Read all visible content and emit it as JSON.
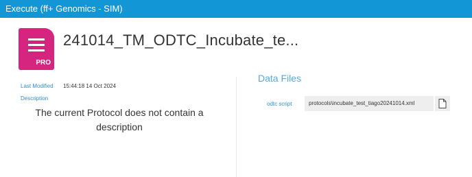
{
  "window": {
    "title": "Execute  (ff+ Genomics - SIM)"
  },
  "protocol": {
    "icon": "protocol-pro-icon",
    "icon_badge": "PRO",
    "icon_color": "#d6257f",
    "title": "241014_TM_ODTC_Incubate_te..."
  },
  "details": {
    "last_modified_label": "Last Modified",
    "last_modified_value": "15:44:18 14 Oct 2024",
    "description_label": "Description",
    "description_text": "The current Protocol does not contain a description"
  },
  "data_files": {
    "heading": "Data Files",
    "items": [
      {
        "label": "odtc script",
        "value": "protocols\\incubate_test_tiago20241014.xml",
        "button_icon": "file-icon"
      }
    ]
  },
  "colors": {
    "titlebar": "#1296d6",
    "accent": "#2a8fd0"
  }
}
